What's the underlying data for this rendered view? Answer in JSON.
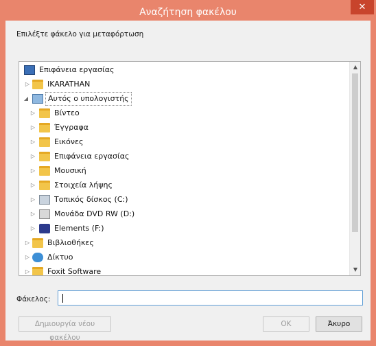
{
  "window": {
    "title": "Αναζήτηση φακέλου",
    "close_glyph": "✕",
    "accent": "#e9856c"
  },
  "prompt": "Επιλέξτε φάκελο για μεταφόρτωση",
  "tree": {
    "items": [
      {
        "label": "Επιφάνεια εργασίας",
        "icon": "desktop-icon",
        "toggle": ""
      },
      {
        "label": "IKARATHAN",
        "icon": "user-folder-icon",
        "toggle": "▷"
      },
      {
        "label": "Αυτός ο υπολογιστής",
        "icon": "computer-icon",
        "toggle": "◢"
      },
      {
        "label": "Βίντεο",
        "icon": "videos-folder-icon",
        "toggle": "▷"
      },
      {
        "label": "Έγγραφα",
        "icon": "documents-folder-icon",
        "toggle": "▷"
      },
      {
        "label": "Εικόνες",
        "icon": "pictures-folder-icon",
        "toggle": "▷"
      },
      {
        "label": "Επιφάνεια εργασίας",
        "icon": "desktop-folder-icon",
        "toggle": "▷"
      },
      {
        "label": "Μουσική",
        "icon": "music-folder-icon",
        "toggle": "▷"
      },
      {
        "label": "Στοιχεία λήψης",
        "icon": "downloads-folder-icon",
        "toggle": "▷"
      },
      {
        "label": "Τοπικός δίσκος (C:)",
        "icon": "local-disk-icon",
        "toggle": "▷"
      },
      {
        "label": "Μονάδα DVD RW (D:)",
        "icon": "dvd-drive-icon",
        "toggle": "▷"
      },
      {
        "label": "Elements (F:)",
        "icon": "wd-drive-icon",
        "toggle": "▷"
      },
      {
        "label": "Βιβλιοθήκες",
        "icon": "libraries-icon",
        "toggle": "▷"
      },
      {
        "label": "Δίκτυο",
        "icon": "network-icon",
        "toggle": "▷"
      },
      {
        "label": "Foxit Software",
        "icon": "folder-icon",
        "toggle": "▷"
      }
    ],
    "scroll_up": "▲",
    "scroll_down": "▼"
  },
  "folder_field": {
    "label": "Φάκελος:",
    "value": ""
  },
  "buttons": {
    "new_folder": "Δημιουργία νέου φακέλου",
    "ok": "OK",
    "cancel": "Άκυρο"
  }
}
